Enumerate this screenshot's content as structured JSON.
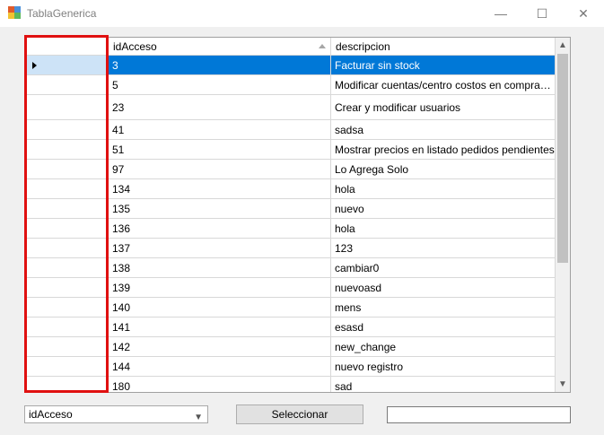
{
  "window": {
    "title": "TablaGenerica",
    "minimize_glyph": "—",
    "maximize_glyph": "☐",
    "close_glyph": "✕"
  },
  "grid": {
    "columns": [
      "idAcceso",
      "descripcion"
    ],
    "sort_indicator": "sort-ascending-icon",
    "selected_row": 0,
    "rows": [
      {
        "idAcceso": "3",
        "descripcion": "Facturar sin stock"
      },
      {
        "idAcceso": "5",
        "descripcion": "Modificar cuentas/centro costos en compras y v..."
      },
      {
        "idAcceso": "23",
        "descripcion": "Crear y modificar usuarios"
      },
      {
        "idAcceso": "41",
        "descripcion": "sadsa"
      },
      {
        "idAcceso": "51",
        "descripcion": "Mostrar precios en listado pedidos pendientes"
      },
      {
        "idAcceso": "97",
        "descripcion": "Lo Agrega Solo"
      },
      {
        "idAcceso": "134",
        "descripcion": "hola"
      },
      {
        "idAcceso": "135",
        "descripcion": "nuevo"
      },
      {
        "idAcceso": "136",
        "descripcion": "hola"
      },
      {
        "idAcceso": "137",
        "descripcion": "123"
      },
      {
        "idAcceso": "138",
        "descripcion": "cambiar0"
      },
      {
        "idAcceso": "139",
        "descripcion": "nuevoasd"
      },
      {
        "idAcceso": "140",
        "descripcion": "mens"
      },
      {
        "idAcceso": "141",
        "descripcion": "esasd"
      },
      {
        "idAcceso": "142",
        "descripcion": "new_change"
      },
      {
        "idAcceso": "144",
        "descripcion": "nuevo registro"
      },
      {
        "idAcceso": "180",
        "descripcion": "sad"
      }
    ]
  },
  "footer": {
    "combo_value": "idAcceso",
    "select_button": "Seleccionar",
    "search_value": ""
  },
  "colors": {
    "selection": "#0078d7",
    "highlight_box": "#e01010"
  }
}
